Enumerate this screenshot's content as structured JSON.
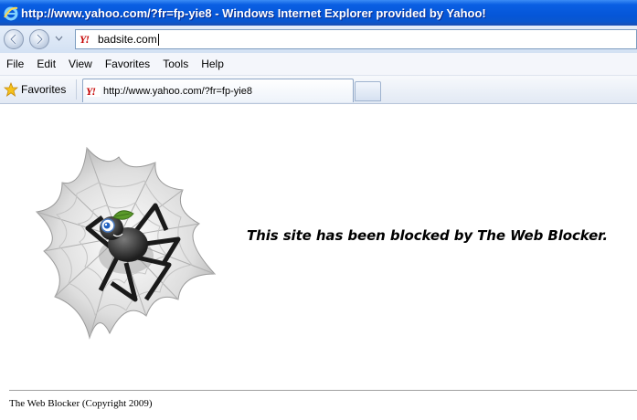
{
  "window": {
    "title": "http://www.yahoo.com/?fr=fp-yie8 - Windows Internet Explorer provided by Yahoo!"
  },
  "address_bar": {
    "value": "badsite.com",
    "favicon": "yahoo-y-icon",
    "favicon_text": "Y!"
  },
  "menu": {
    "items": [
      {
        "label": "File"
      },
      {
        "label": "Edit"
      },
      {
        "label": "View"
      },
      {
        "label": "Favorites"
      },
      {
        "label": "Tools"
      },
      {
        "label": "Help"
      }
    ]
  },
  "favorites_bar": {
    "favorites_label": "Favorites",
    "tabs": [
      {
        "label": "http://www.yahoo.com/?fr=fp-yie8",
        "active": true
      }
    ]
  },
  "page": {
    "blocked_message": "This site has been blocked by The Web Blocker.",
    "footer": "The Web Blocker (Copyright 2009)"
  },
  "colors": {
    "titlebar": "#0556d8",
    "accent_green": "#5a9a2a"
  }
}
